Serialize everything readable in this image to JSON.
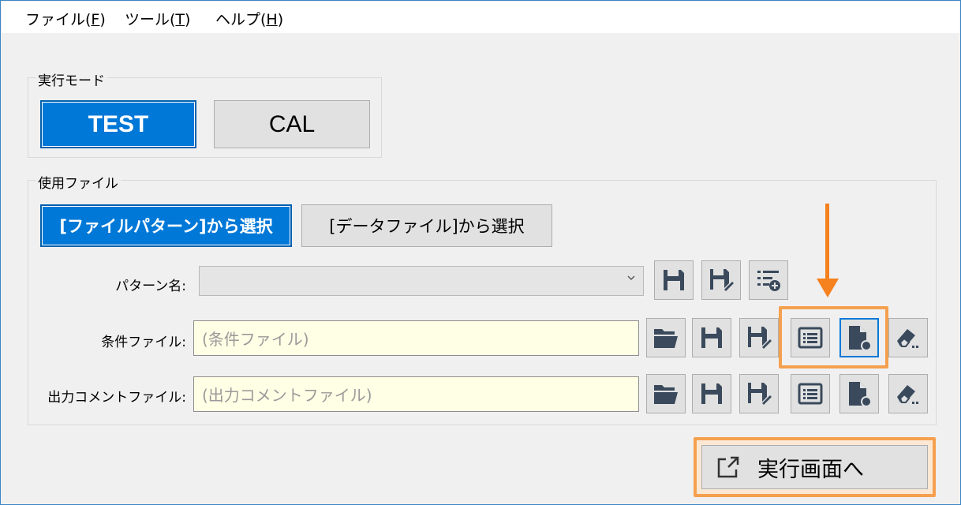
{
  "menu": {
    "file": {
      "text": "ファイル(",
      "key": "F",
      "end": ")"
    },
    "tools": {
      "text": "ツール(",
      "key": "T",
      "end": ")"
    },
    "help": {
      "text": "ヘルプ(",
      "key": "H",
      "end": ")"
    }
  },
  "mode_group": {
    "title": "実行モード",
    "test_label": "TEST",
    "cal_label": "CAL",
    "selected": "TEST"
  },
  "file_group": {
    "title": "使用ファイル",
    "pattern_select_label": "[ファイルパターン]から選択",
    "data_select_label": "[データファイル]から選択",
    "selected": "pattern"
  },
  "pattern_row": {
    "label": "パターン名:",
    "value": ""
  },
  "condition_row": {
    "label": "条件ファイル:",
    "placeholder": "(条件ファイル)"
  },
  "comment_row": {
    "label": "出力コメントファイル:",
    "placeholder": "(出力コメントファイル)"
  },
  "exec_button": {
    "label": "実行画面へ"
  },
  "icons": [
    "folder-open-icon",
    "save-icon",
    "save-as-icon",
    "list-view-icon",
    "new-document-icon",
    "eraser-icon",
    "add-list-icon",
    "external-link-icon"
  ],
  "colors": {
    "accent": "#0078d7",
    "annotation": "#f5a04f",
    "input_bg": "#ffffe5",
    "icon": "#3a4a5c"
  }
}
